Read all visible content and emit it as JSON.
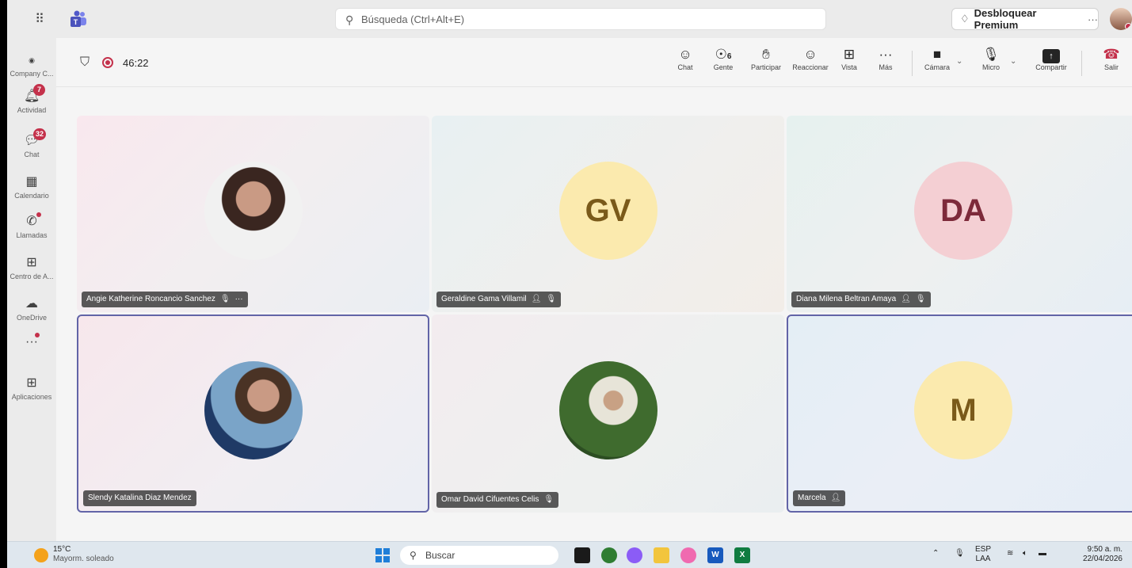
{
  "titlebar": {
    "search_placeholder": "Búsqueda (Ctrl+Alt+E)",
    "premium_label": "Desbloquear Premium",
    "premium_more": "···",
    "apps_icon": "waffle-grid-icon",
    "teams_icon": "teams-logo-icon"
  },
  "rail": {
    "items": [
      {
        "label": "Company C...",
        "icon": "org-icon"
      },
      {
        "label": "Actividad",
        "icon": "bell-icon",
        "badge": "7"
      },
      {
        "label": "Chat",
        "icon": "chat-icon",
        "badge": "32"
      },
      {
        "label": "Calendario",
        "icon": "calendar-icon"
      },
      {
        "label": "Llamadas",
        "icon": "phone-icon"
      },
      {
        "label": "Centro de A...",
        "icon": "apps-center-icon"
      },
      {
        "label": "OneDrive",
        "icon": "cloud-icon"
      },
      {
        "label": "···",
        "icon": "more-icon"
      },
      {
        "label": "Aplicaciones",
        "icon": "add-app-icon"
      }
    ]
  },
  "meeting": {
    "timer": "46:22",
    "toolbar": {
      "chat": "Chat",
      "people": "Gente",
      "people_count": "6",
      "raise": "Participar",
      "react": "Reaccionar",
      "view": "Vista",
      "more": "Más",
      "more_glyph": "···",
      "camera": "Cámara",
      "mic": "Micro",
      "share": "Compartir",
      "leave": "Salir"
    }
  },
  "participants": [
    {
      "name": "Angie Katherine Roncancio Sanchez",
      "initials": "",
      "muted": true,
      "more": "···"
    },
    {
      "name": "Geraldine Gama Villamil",
      "initials": "GV",
      "muted": true
    },
    {
      "name": "Diana Milena Beltran Amaya",
      "initials": "DA",
      "muted": true
    },
    {
      "name": "Slendy Katalina Diaz Mendez",
      "initials": "",
      "muted": false
    },
    {
      "name": "Omar David Cifuentes Celis",
      "initials": "",
      "muted": true
    },
    {
      "name": "Marcela",
      "initials": "M",
      "muted": false
    }
  ],
  "taskbar": {
    "temperature": "15°C",
    "weather": "Mayorm. soleado",
    "search": "Buscar",
    "lang_top": "ESP",
    "lang_bottom": "LAA",
    "time": "9:50 a. m.",
    "date": "22/04/2026"
  }
}
